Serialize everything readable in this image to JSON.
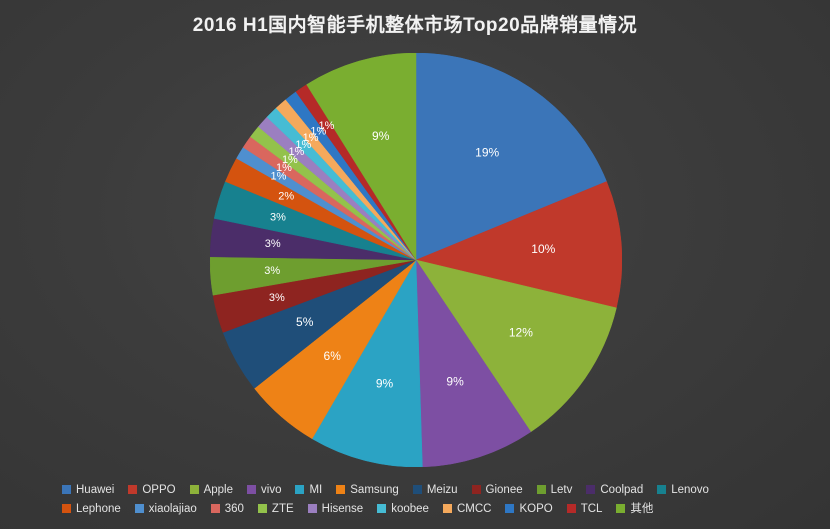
{
  "chart": {
    "title": "2016 H1国内智能手机整体市场Top20品牌销量情况"
  },
  "chart_data": {
    "type": "pie",
    "title": "2016 H1国内智能手机整体市场Top20品牌销量情况",
    "xlabel": "",
    "ylabel": "",
    "legend_position": "bottom",
    "grid": false,
    "value_unit": "%",
    "start_angle_deg": 0,
    "direction": "clockwise",
    "categories": [
      "Huawei",
      "OPPO",
      "Apple",
      "vivo",
      "MI",
      "Samsung",
      "Meizu",
      "Gionee",
      "Letv",
      "Coolpad",
      "Lenovo",
      "Lephone",
      "xiaolajiao",
      "360",
      "ZTE",
      "Hisense",
      "koobee",
      "CMCC",
      "KOPO",
      "TCL",
      "其他"
    ],
    "values": [
      19,
      10,
      12,
      9,
      9,
      6,
      5,
      3,
      3,
      3,
      3,
      2,
      1,
      1,
      1,
      1,
      1,
      1,
      1,
      1,
      9
    ],
    "labels": [
      "19%",
      "10%",
      "12%",
      "9%",
      "9%",
      "6%",
      "5%",
      "3%",
      "3%",
      "3%",
      "3%",
      "2%",
      "1%",
      "1%",
      "1%",
      "1%",
      "1%",
      "1%",
      "1%",
      "1%",
      "9%"
    ],
    "colors": [
      "#3b75b8",
      "#c0392b",
      "#8db23a",
      "#7d4fa3",
      "#2ba3c4",
      "#ee8216",
      "#1f4e79",
      "#8e2420",
      "#6e9e2f",
      "#4b2d69",
      "#17818f",
      "#d4530f",
      "#4f8fcf",
      "#d9675e",
      "#93c24b",
      "#9b7fc0",
      "#46bcd4",
      "#f5a95c",
      "#2e77c4",
      "#b52a28",
      "#7aae30"
    ]
  },
  "legend": {
    "rows": [
      [
        {
          "label": "Huawei",
          "color": "#3b75b8"
        },
        {
          "label": "OPPO",
          "color": "#c0392b"
        },
        {
          "label": "Apple",
          "color": "#8db23a"
        },
        {
          "label": "vivo",
          "color": "#7d4fa3"
        },
        {
          "label": "MI",
          "color": "#2ba3c4"
        },
        {
          "label": "Samsung",
          "color": "#ee8216"
        },
        {
          "label": "Meizu",
          "color": "#1f4e79"
        },
        {
          "label": "Gionee",
          "color": "#8e2420"
        },
        {
          "label": "Letv",
          "color": "#6e9e2f"
        },
        {
          "label": "Coolpad",
          "color": "#4b2d69"
        },
        {
          "label": "Lenovo",
          "color": "#17818f"
        }
      ],
      [
        {
          "label": "Lephone",
          "color": "#d4530f"
        },
        {
          "label": "xiaolajiao",
          "color": "#4f8fcf"
        },
        {
          "label": "360",
          "color": "#d9675e"
        },
        {
          "label": "ZTE",
          "color": "#93c24b"
        },
        {
          "label": "Hisense",
          "color": "#9b7fc0"
        },
        {
          "label": "koobee",
          "color": "#46bcd4"
        },
        {
          "label": "CMCC",
          "color": "#f5a95c"
        },
        {
          "label": "KOPO",
          "color": "#2e77c4"
        },
        {
          "label": "TCL",
          "color": "#b52a28"
        },
        {
          "label": "其他",
          "color": "#7aae30"
        }
      ]
    ]
  }
}
